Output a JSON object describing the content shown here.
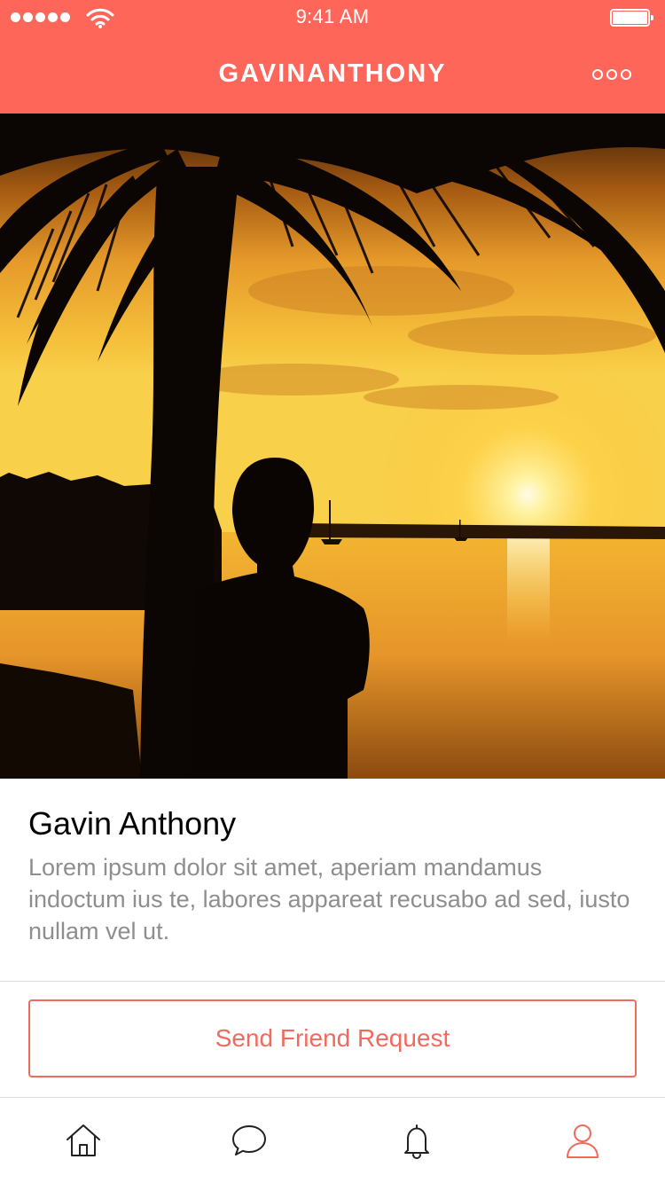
{
  "status_bar": {
    "time": "9:41 AM",
    "signal_icon": "signal-dots-icon",
    "wifi_icon": "wifi-icon",
    "battery_icon": "battery-icon",
    "battery_level": 1.0
  },
  "nav": {
    "title": "GAVINANTHONY",
    "more_icon": "more-icon"
  },
  "colors": {
    "header": "#FF665A",
    "accent": "#F06A5E",
    "bio_text": "#8E8E8E",
    "divider": "#DCDCDC"
  },
  "profile": {
    "photo_icon": "profile-photo",
    "name": "Gavin Anthony",
    "bio": "Lorem ipsum dolor sit amet, aperiam mandamus indoctum ius te, labores appareat recusabo ad sed, iusto nullam vel ut."
  },
  "actions": {
    "friend_request_label": "Send Friend Request"
  },
  "tab_bar": {
    "tabs": [
      {
        "icon": "home-icon",
        "active": false
      },
      {
        "icon": "chat-icon",
        "active": false
      },
      {
        "icon": "bell-icon",
        "active": false
      },
      {
        "icon": "profile-icon",
        "active": true
      }
    ]
  }
}
